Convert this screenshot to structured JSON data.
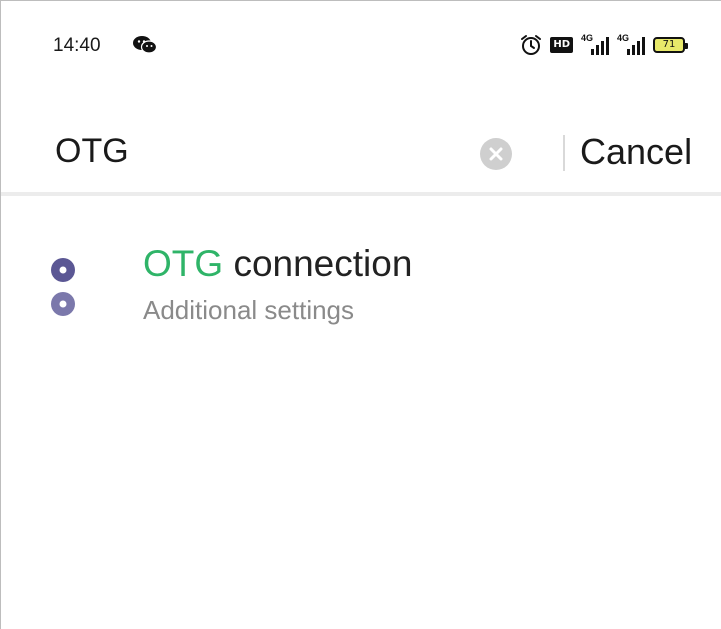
{
  "status_bar": {
    "time": "14:40",
    "hd_label": "HD",
    "signal_1_label": "4G",
    "signal_2_label": "4G",
    "battery_level": "71",
    "icons": [
      "wechat-icon",
      "alarm-icon",
      "hd-icon",
      "signal-icon",
      "signal-icon",
      "battery-icon"
    ]
  },
  "search": {
    "query": "OTG",
    "cancel_label": "Cancel"
  },
  "results": [
    {
      "title_highlight": "OTG",
      "title_rest": " connection",
      "subtitle": "Additional settings",
      "icon": "settings-dots-icon"
    }
  ],
  "colors": {
    "highlight": "#2fb468",
    "icon_purple": "#5b5794",
    "subtitle_gray": "#8a8a8a"
  }
}
